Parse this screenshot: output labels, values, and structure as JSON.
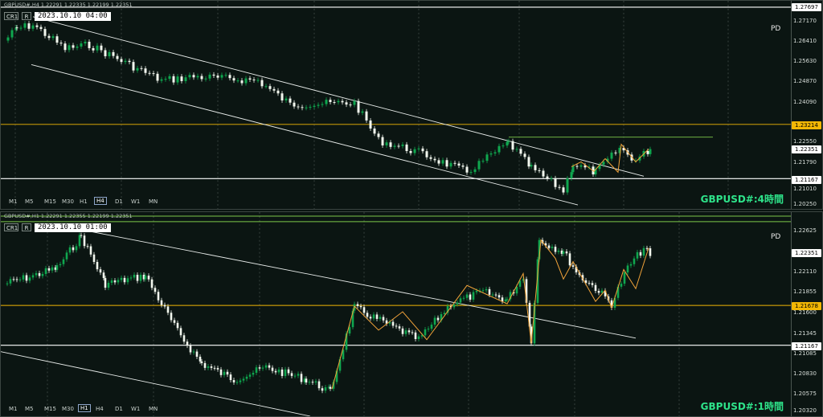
{
  "colors": {
    "background": "#0b1512",
    "bull": "#0fa74f",
    "bear": "#f2f7ee",
    "level_white": "#ffffff",
    "level_orange": "#f2b705",
    "level_green": "#7cc84a",
    "zigzag": "#f2a33a",
    "caption": "#2ee38a"
  },
  "timeframes": [
    "M1",
    "M5",
    "M15",
    "M30",
    "H1",
    "H4",
    "D1",
    "W1",
    "MN"
  ],
  "top": {
    "header": "GBPUSD#,H4  1.22291 1.22335 1.22199 1.22351",
    "btn_cr": "CR1",
    "btn_r": "R",
    "date": "2023.10.10 04:00",
    "pd": "PD",
    "caption": "GBPUSD#:4時間",
    "active_tf": "H4",
    "axis_ticks": [
      "1.27697",
      "1.27170",
      "1.26410",
      "1.25630",
      "1.24870",
      "1.24090",
      "1.23214",
      "1.22550",
      "1.22351",
      "1.21790",
      "1.21167",
      "1.21010",
      "1.20250"
    ],
    "tag_orange": "1.23214",
    "tag_white_1": "1.22351",
    "tag_white_2": "1.21167",
    "tag_white_top": "1.27697"
  },
  "bottom": {
    "header": "GBPUSD#,H1  1.22291 1.22355 1.22199 1.22351",
    "btn_cr": "CR1",
    "btn_r": "R",
    "date": "2023.10.10 01:00",
    "pd": "PD",
    "caption": "GBPUSD#:1時間",
    "active_tf": "H1",
    "axis_ticks": [
      "1.22625",
      "1.22351",
      "1.22110",
      "1.21855",
      "1.21678",
      "1.21600",
      "1.21345",
      "1.21167",
      "1.21085",
      "1.20830",
      "1.20575",
      "1.20320"
    ],
    "tag_orange": "1.21678",
    "tag_white_1": "1.22351",
    "tag_white_2": "1.21167"
  }
}
